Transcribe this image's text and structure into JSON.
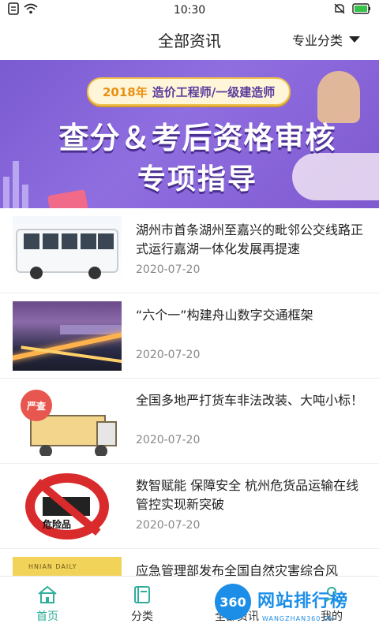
{
  "status_bar": {
    "time": "10:30",
    "icons": [
      "notification-icon",
      "wifi-icon",
      "mute-icon",
      "battery-icon"
    ]
  },
  "header": {
    "title": "全部资讯",
    "filter_label": "专业分类"
  },
  "banner": {
    "year": "2018年",
    "subtitle": "造价工程师/一级建造师",
    "line1": "查分＆考后资格审核",
    "line2": "专项指导"
  },
  "news": [
    {
      "title": "湖州市首条湖州至嘉兴的毗邻公交线路正式运行嘉湖一体化发展再提速",
      "date": "2020-07-20",
      "thumb": "bus"
    },
    {
      "title": "“六个一”构建舟山数字交通框架",
      "date": "2020-07-20",
      "thumb": "city"
    },
    {
      "title": "全国多地严打货车非法改装、大吨小标！",
      "date": "2020-07-20",
      "thumb": "truck",
      "thumb_text": "严查"
    },
    {
      "title": "数智赋能 保障安全 杭州危货品运输在线管控实现新突破",
      "date": "2020-07-20",
      "thumb": "hazard",
      "thumb_text": "危险品"
    },
    {
      "title": "应急管理部发布全国自然灾害综合风",
      "date": "",
      "thumb": "paper",
      "thumb_text": "HNIAN DAILY"
    }
  ],
  "bottom_nav": {
    "items": [
      {
        "label": "首页",
        "icon": "home-icon"
      },
      {
        "label": "分类",
        "icon": "book-icon"
      },
      {
        "label": "全部资讯",
        "icon": "news-icon",
        "active": true
      },
      {
        "label": "我的",
        "icon": "user-icon"
      }
    ],
    "active_color": "#2fae9b"
  },
  "watermark": {
    "logo": "360",
    "text": "网站排行榜",
    "url": "WANGZHAN360.CN"
  }
}
